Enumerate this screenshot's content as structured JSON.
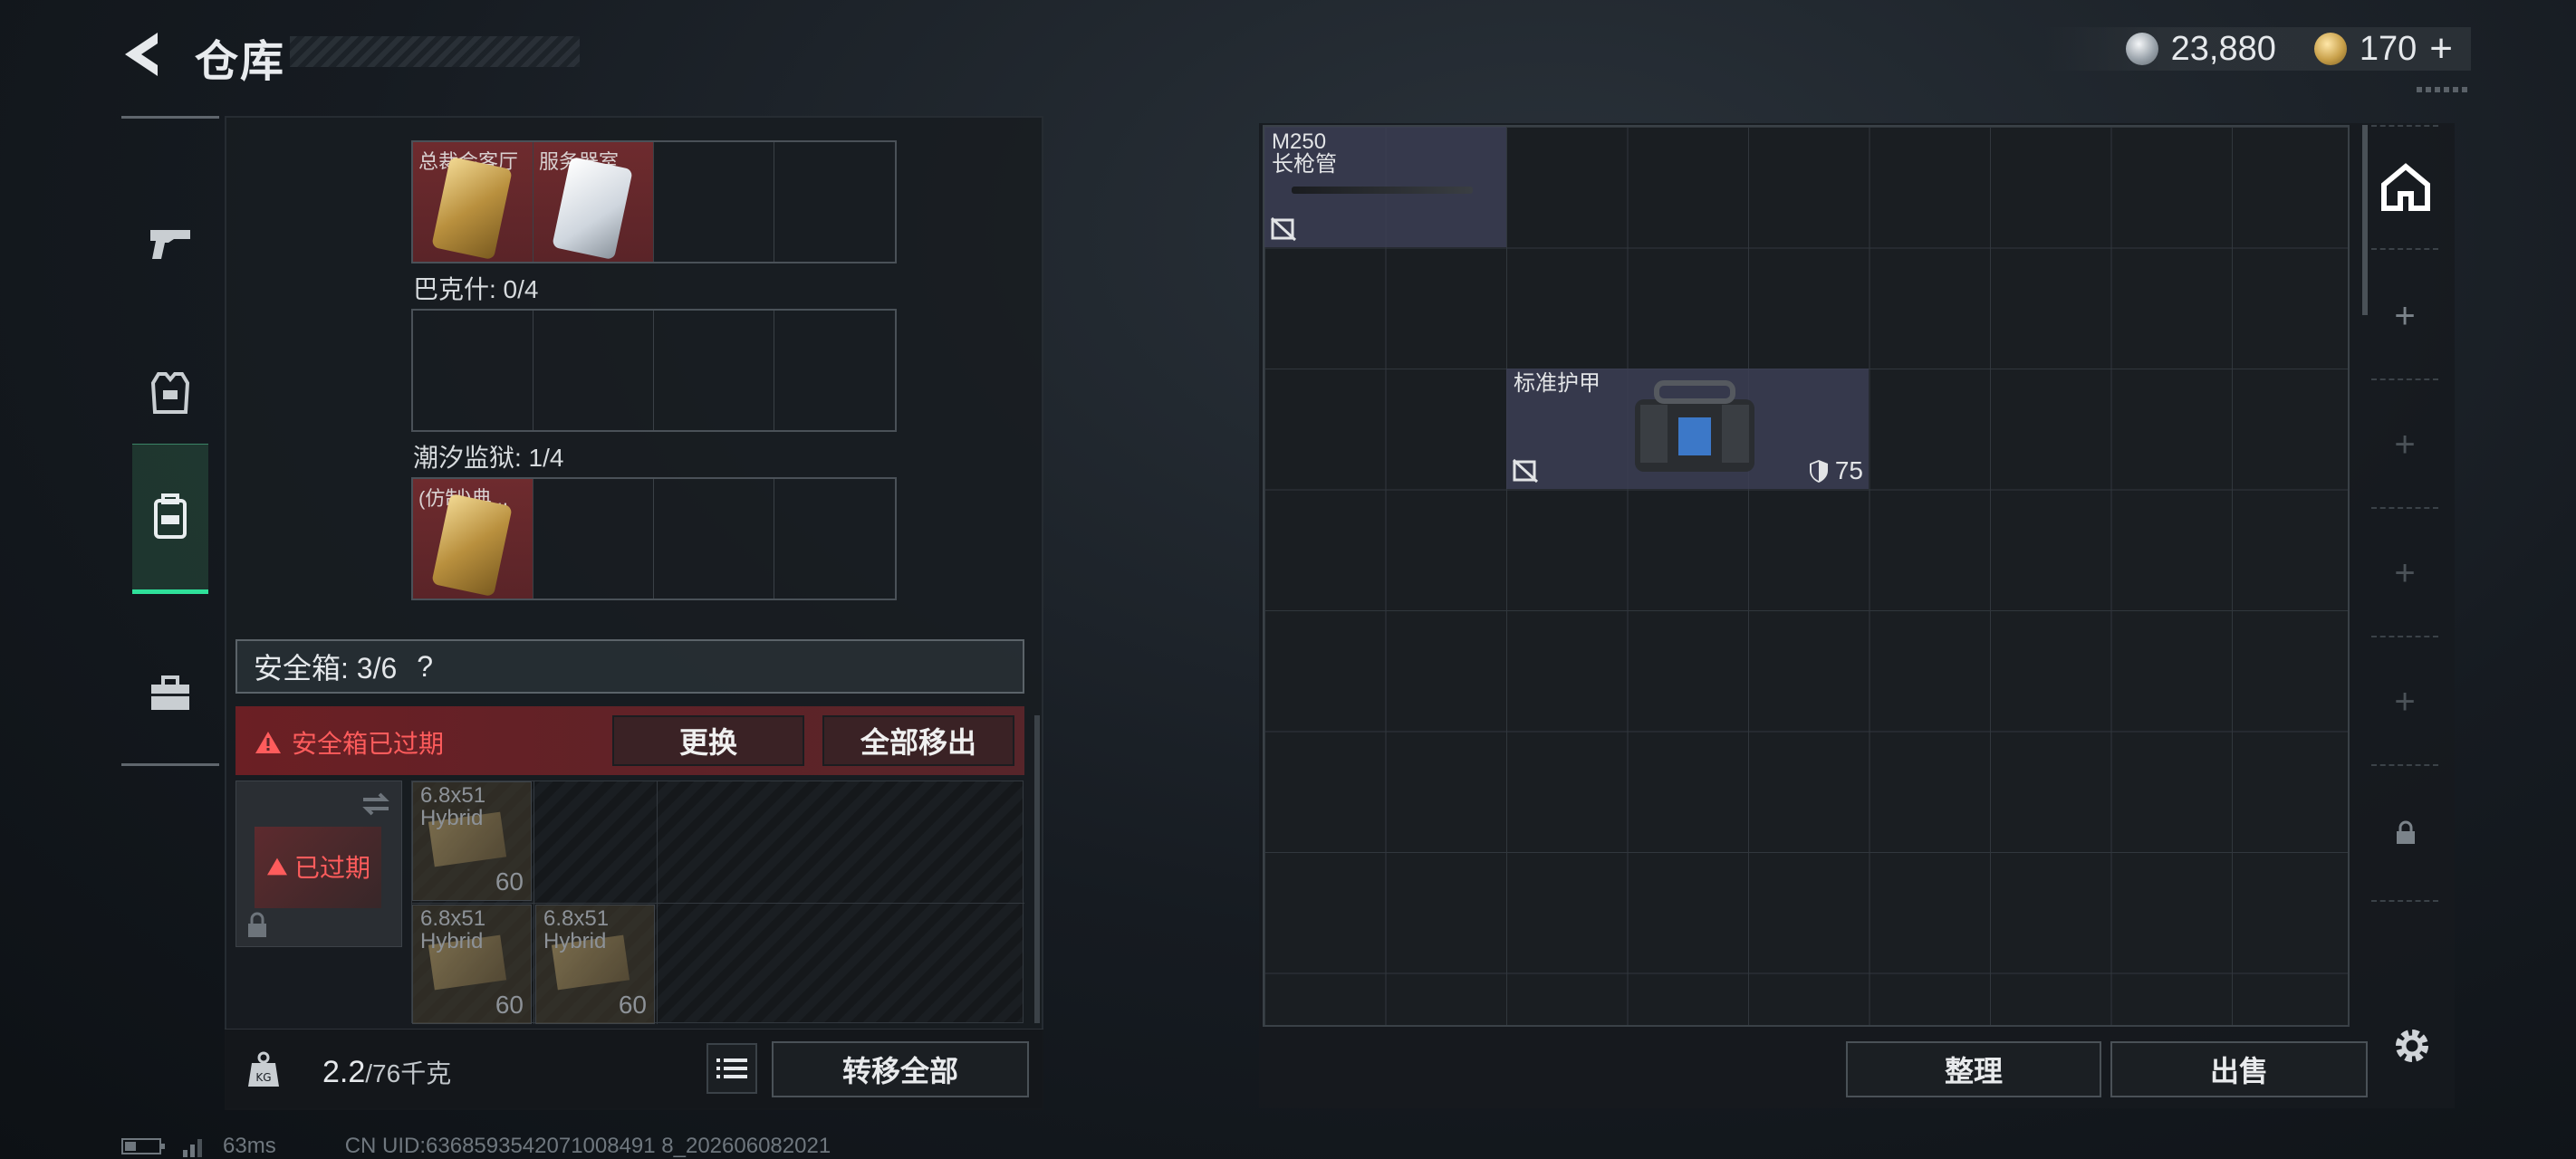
{
  "header": {
    "title": "仓库",
    "silver_amount": "23,880",
    "gold_amount": "170",
    "gold_plus": "+"
  },
  "rail": {
    "items": [
      {
        "icon": "pistol-icon",
        "active": false
      },
      {
        "icon": "armor-vest-icon",
        "active": false
      },
      {
        "icon": "backpack-icon",
        "active": true
      },
      {
        "icon": "toolbox-icon",
        "active": false
      }
    ]
  },
  "left": {
    "group1": {
      "cards": [
        "总裁会客厅",
        "服务器室"
      ]
    },
    "group2": {
      "label": "巴克什: 0/4"
    },
    "group3": {
      "label": "潮汐监狱: 1/4",
      "cards": [
        "(仿制)典..."
      ]
    },
    "safebox": {
      "label": "安全箱: 3/6",
      "help": "?",
      "expired_msg": "安全箱已过期",
      "replace_label": "更换",
      "remove_all_label": "全部移出",
      "slot_status": "已过期"
    },
    "ammo": [
      {
        "name": "6.8x51\nHybrid",
        "count": "60"
      },
      {
        "name": "6.8x51\nHybrid",
        "count": "60"
      },
      {
        "name": "6.8x51\nHybrid",
        "count": "60"
      }
    ],
    "footer": {
      "weight": "2.2",
      "weight_unit": "/76千克",
      "transfer_all_label": "转移全部"
    }
  },
  "stash": {
    "items": [
      {
        "name": "M250\n长枪管"
      },
      {
        "name": "标准护甲",
        "durability": "75"
      }
    ],
    "sort_label": "整理",
    "sell_label": "出售"
  },
  "status": {
    "ping": "63ms",
    "uid": "CN UID:6368593542071008491 8_202606082021"
  },
  "colors": {
    "accent_green": "#2fe09a",
    "danger_red": "#ff5c5c",
    "card_red": "#6e2b2e"
  }
}
